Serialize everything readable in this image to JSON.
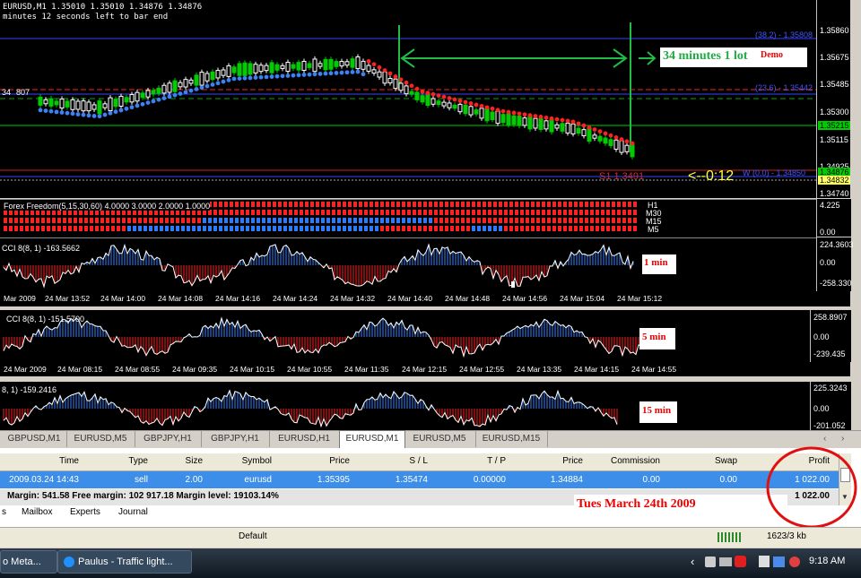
{
  "main_chart": {
    "header_line1": "EURUSD,M1  1.35010 1.35010 1.34876 1.34876",
    "header_line2": "minutes 12 seconds left to bar end",
    "left_label": "34",
    "left_label2": "807",
    "price_axis": [
      "1.35860",
      "1.35675",
      "1.35485",
      "1.35300",
      "1.35115",
      "1.34925",
      "1.34740"
    ],
    "highlight_prices": [
      {
        "text": "1.35215",
        "color": "#00cc00"
      },
      {
        "text": "1.34876",
        "color": "#00cc00"
      },
      {
        "text": "1.34832",
        "color": "#ffff66"
      }
    ],
    "fib_382": "(38.2) - 1.35808",
    "fib_236": "(23.6) - 1.35442",
    "fib_0": "(0.0) - 1.34850",
    "fib_0_prefix": "W",
    "s1_label": "S1 1.3491",
    "countdown": "<--0:12",
    "annotation": "34 minutes 1 lot",
    "annotation_demo": "Demo",
    "colors": {
      "bull": "#3b82f6",
      "bear": "#ff2020",
      "candle_up": "#00cc00",
      "candle_dn": "#ffffff"
    }
  },
  "freedom": {
    "title": "Forex Freedom(5,15,30,60) 4.0000 3.0000 2.0000 1.0000",
    "labels": [
      "H1",
      "M30",
      "M15",
      "M5"
    ],
    "axis": [
      "4.225",
      "0.00"
    ]
  },
  "cci1": {
    "title": "CCI 8(8, 1) -163.5662",
    "axis": [
      "224.3603",
      "0.00",
      "-258.330"
    ],
    "label": "1 min",
    "times": [
      "Mar 2009",
      "24 Mar 13:52",
      "24 Mar 14:00",
      "24 Mar 14:08",
      "24 Mar 14:16",
      "24 Mar 14:24",
      "24 Mar 14:32",
      "24 Mar 14:40",
      "24 Mar 14:48",
      "24 Mar 14:56",
      "24 Mar 15:04",
      "24 Mar 15:12"
    ]
  },
  "cci5": {
    "title": "CCI 8(8, 1) -151.5700",
    "axis": [
      "258.8907",
      "0.00",
      "-239.435"
    ],
    "label": "5 min",
    "times": [
      "24 Mar 2009",
      "24 Mar 08:15",
      "24 Mar 08:55",
      "24 Mar 09:35",
      "24 Mar 10:15",
      "24 Mar 10:55",
      "24 Mar 11:35",
      "24 Mar 12:15",
      "24 Mar 12:55",
      "24 Mar 13:35",
      "24 Mar 14:15",
      "24 Mar 14:55"
    ]
  },
  "cci15": {
    "title": "8, 1) -159.2416",
    "axis": [
      "225.3243",
      "0.00",
      "-201.052"
    ],
    "label": "15 min"
  },
  "chart_tabs": [
    "GBPUSD,M1",
    "EURUSD,M5",
    "GBPJPY,H1",
    "GBPJPY,H1",
    "EURUSD,H1",
    "EURUSD,M1",
    "EURUSD,M5",
    "EURUSD,M15"
  ],
  "active_tab": "EURUSD,M1",
  "terminal": {
    "headers": [
      "Time",
      "Type",
      "Size",
      "Symbol",
      "Price",
      "S / L",
      "T / P",
      "Price",
      "Commission",
      "Swap",
      "Profit"
    ],
    "row": [
      "2009.03.24 14:43",
      "sell",
      "2.00",
      "eurusd",
      "1.35395",
      "1.35474",
      "0.00000",
      "1.34884",
      "0.00",
      "0.00",
      "1 022.00"
    ],
    "balance_line": "Margin: 541.58  Free margin: 102 917.18  Margin level: 19103.14%",
    "balance_total": "1 022.00",
    "date_note": "Tues March 24th 2009",
    "bottom_tabs": [
      "s",
      "Mailbox",
      "Experts",
      "Journal"
    ]
  },
  "status": {
    "profile": "Default",
    "traffic": "1623/3 kb"
  },
  "taskbar": {
    "item1": "o Meta...",
    "item2": "Paulus - Traffic light...",
    "clock": "9:18 AM"
  }
}
